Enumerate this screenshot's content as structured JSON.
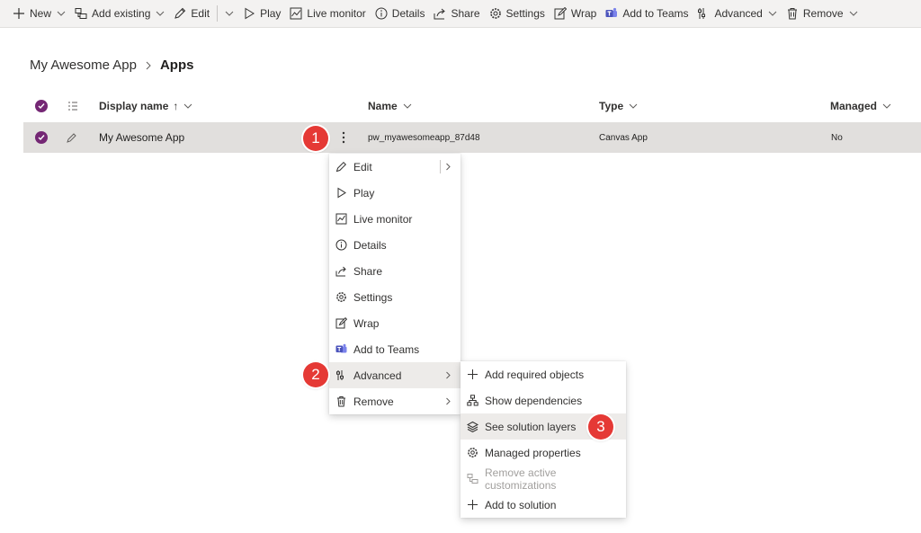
{
  "toolbar": {
    "new": "New",
    "add_existing": "Add existing",
    "edit": "Edit",
    "play": "Play",
    "live_monitor": "Live monitor",
    "details": "Details",
    "share": "Share",
    "settings": "Settings",
    "wrap": "Wrap",
    "add_to_teams": "Add to Teams",
    "advanced": "Advanced",
    "remove": "Remove"
  },
  "breadcrumb": {
    "parent": "My Awesome App",
    "current": "Apps"
  },
  "table": {
    "columns": {
      "display_name": "Display name",
      "sort_arrow": "↑",
      "name": "Name",
      "type": "Type",
      "managed": "Managed"
    },
    "rows": [
      {
        "display_name": "My Awesome App",
        "name": "pw_myawesomeapp_87d48",
        "type": "Canvas App",
        "managed": "No"
      }
    ]
  },
  "context_menu": {
    "items": [
      "Edit",
      "Play",
      "Live monitor",
      "Details",
      "Share",
      "Settings",
      "Wrap",
      "Add to Teams",
      "Advanced",
      "Remove"
    ]
  },
  "advanced_submenu": {
    "items": [
      "Add required objects",
      "Show dependencies",
      "See solution layers",
      "Managed properties",
      "Remove active customizations",
      "Add to solution"
    ]
  },
  "callouts": [
    "1",
    "2",
    "3"
  ],
  "colors": {
    "accent": "#742774",
    "callout": "#e53935",
    "toolbar_bg": "#f3f2f1",
    "selected_row": "#e1dfdd",
    "teams": "#4b53bc"
  }
}
